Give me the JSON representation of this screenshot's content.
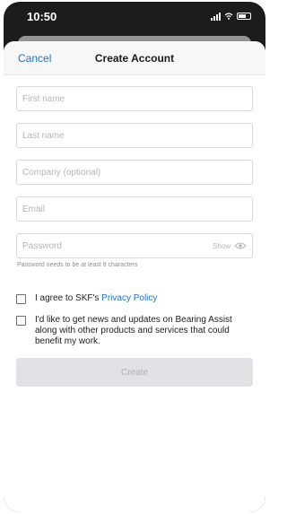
{
  "status_bar": {
    "time": "10:50"
  },
  "nav": {
    "cancel_label": "Cancel",
    "title": "Create Account"
  },
  "form": {
    "first_name": {
      "placeholder": "First name",
      "value": ""
    },
    "last_name": {
      "placeholder": "Last name",
      "value": ""
    },
    "company": {
      "placeholder": "Company (optional)",
      "value": ""
    },
    "email": {
      "placeholder": "Email",
      "value": ""
    },
    "password": {
      "placeholder": "Password",
      "value": "",
      "show_label": "Show",
      "hint": "Password needs to be at least 8 characters"
    }
  },
  "consents": {
    "privacy": {
      "text": "I agree to SKF's ",
      "link": "Privacy Policy",
      "checked": false
    },
    "newsletter": {
      "text": "I'd like to get news and updates on Bearing Assist along with other products and services that could benefit my work.",
      "checked": false
    }
  },
  "actions": {
    "create_label": "Create",
    "create_enabled": false
  },
  "colors": {
    "accent": "#1b73d0",
    "disabled_button": "#e2e2e6",
    "disabled_text": "#b0b0b5"
  }
}
